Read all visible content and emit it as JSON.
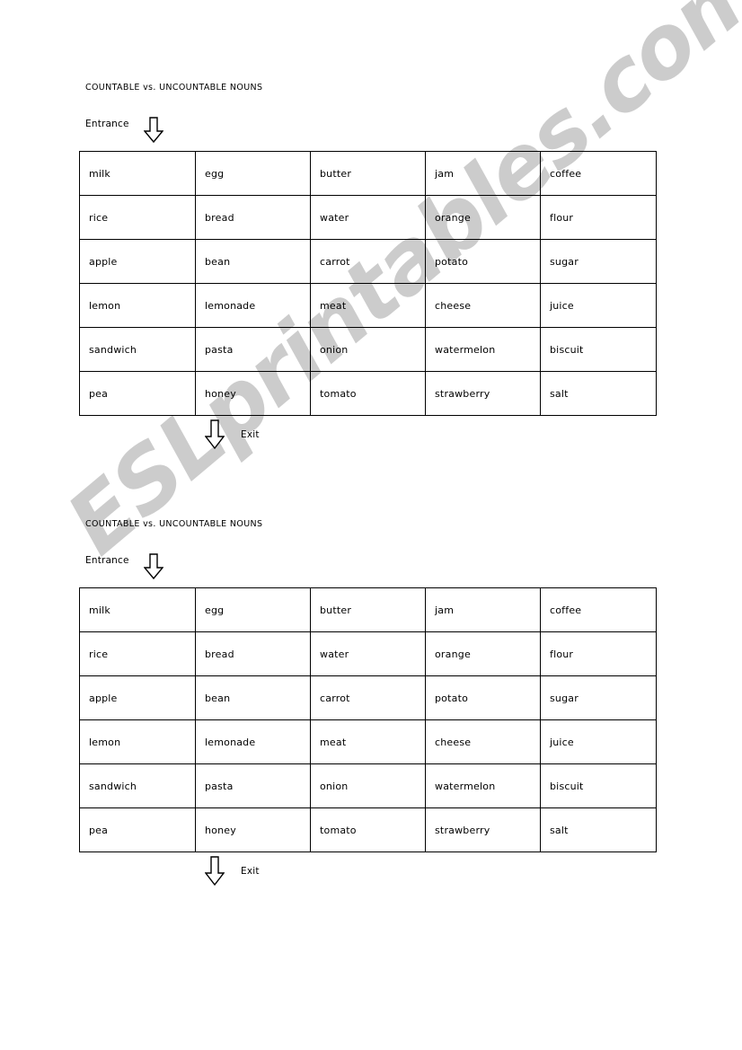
{
  "page": {
    "background_color": "#ffffff",
    "text_color": "#000000",
    "border_color": "#000000"
  },
  "watermark": {
    "text": "ESLprintables.com",
    "color": "#cccccc",
    "rotation_deg": -40
  },
  "worksheets": [
    {
      "id": "worksheet-1",
      "title": "COUNTABLE vs. UNCOUNTABLE NOUNS",
      "entrance_label": "Entrance",
      "entrance_icon": "down-arrow-icon",
      "exit_label": "Exit",
      "exit_icon": "down-arrow-icon",
      "table": {
        "rows": [
          [
            "milk",
            "egg",
            "butter",
            "jam",
            "coffee"
          ],
          [
            "rice",
            "bread",
            "water",
            "orange",
            "flour"
          ],
          [
            "apple",
            "bean",
            "carrot",
            "potato",
            "sugar"
          ],
          [
            "lemon",
            "lemonade",
            "meat",
            "cheese",
            "juice"
          ],
          [
            "sandwich",
            "pasta",
            "onion",
            "watermelon",
            "biscuit"
          ],
          [
            "pea",
            "honey",
            "tomato",
            "strawberry",
            "salt"
          ]
        ]
      }
    },
    {
      "id": "worksheet-2",
      "title": "COUNTABLE vs. UNCOUNTABLE NOUNS",
      "entrance_label": "Entrance",
      "entrance_icon": "down-arrow-icon",
      "exit_label": "Exit",
      "exit_icon": "down-arrow-icon",
      "table": {
        "rows": [
          [
            "milk",
            "egg",
            "butter",
            "jam",
            "coffee"
          ],
          [
            "rice",
            "bread",
            "water",
            "orange",
            "flour"
          ],
          [
            "apple",
            "bean",
            "carrot",
            "potato",
            "sugar"
          ],
          [
            "lemon",
            "lemonade",
            "meat",
            "cheese",
            "juice"
          ],
          [
            "sandwich",
            "pasta",
            "onion",
            "watermelon",
            "biscuit"
          ],
          [
            "pea",
            "honey",
            "tomato",
            "strawberry",
            "salt"
          ]
        ]
      }
    }
  ]
}
